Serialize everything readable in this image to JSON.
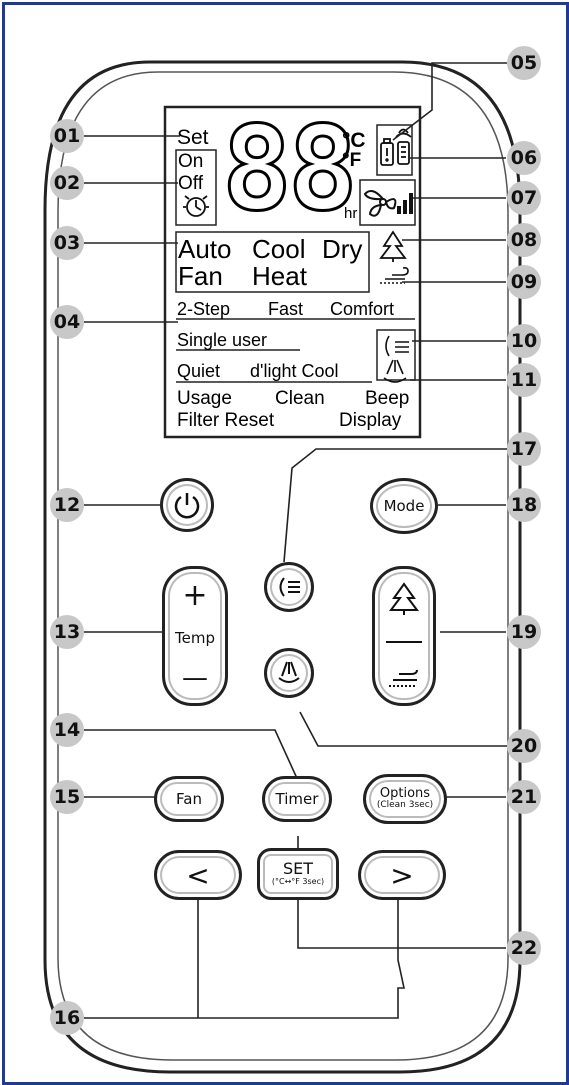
{
  "lcd": {
    "set": "Set",
    "on": "On",
    "off": "Off",
    "digits": "88",
    "unit_c": "°C",
    "unit_f": "°F",
    "unit_hr": "hr",
    "modes_row1": [
      "Auto",
      "Cool",
      "Dry"
    ],
    "modes_row2": [
      "Fan",
      "Heat"
    ],
    "two_step": "2-Step",
    "fast": "Fast",
    "comfort": "Comfort",
    "single_user": "Single user",
    "quiet": "Quiet",
    "dlight_cool": "d'light Cool",
    "usage": "Usage",
    "clean": "Clean",
    "beep": "Beep",
    "filter_reset": "Filter Reset",
    "display": "Display"
  },
  "buttons": {
    "temp_plus": "+",
    "temp": "Temp",
    "temp_minus": "—",
    "mode": "Mode",
    "fan": "Fan",
    "timer": "Timer",
    "options": "Options",
    "options_sub": "(Clean 3sec)",
    "set": "SET",
    "set_sub": "(°C↔°F 3sec)",
    "left": "<",
    "right": ">"
  },
  "callouts": [
    "01",
    "02",
    "03",
    "04",
    "05",
    "06",
    "07",
    "08",
    "09",
    "10",
    "11",
    "12",
    "13",
    "14",
    "15",
    "16",
    "17",
    "18",
    "19",
    "20",
    "21",
    "22"
  ],
  "colors": {
    "frame": "#1f3a93",
    "callout_fill": "#c8c8c8"
  }
}
